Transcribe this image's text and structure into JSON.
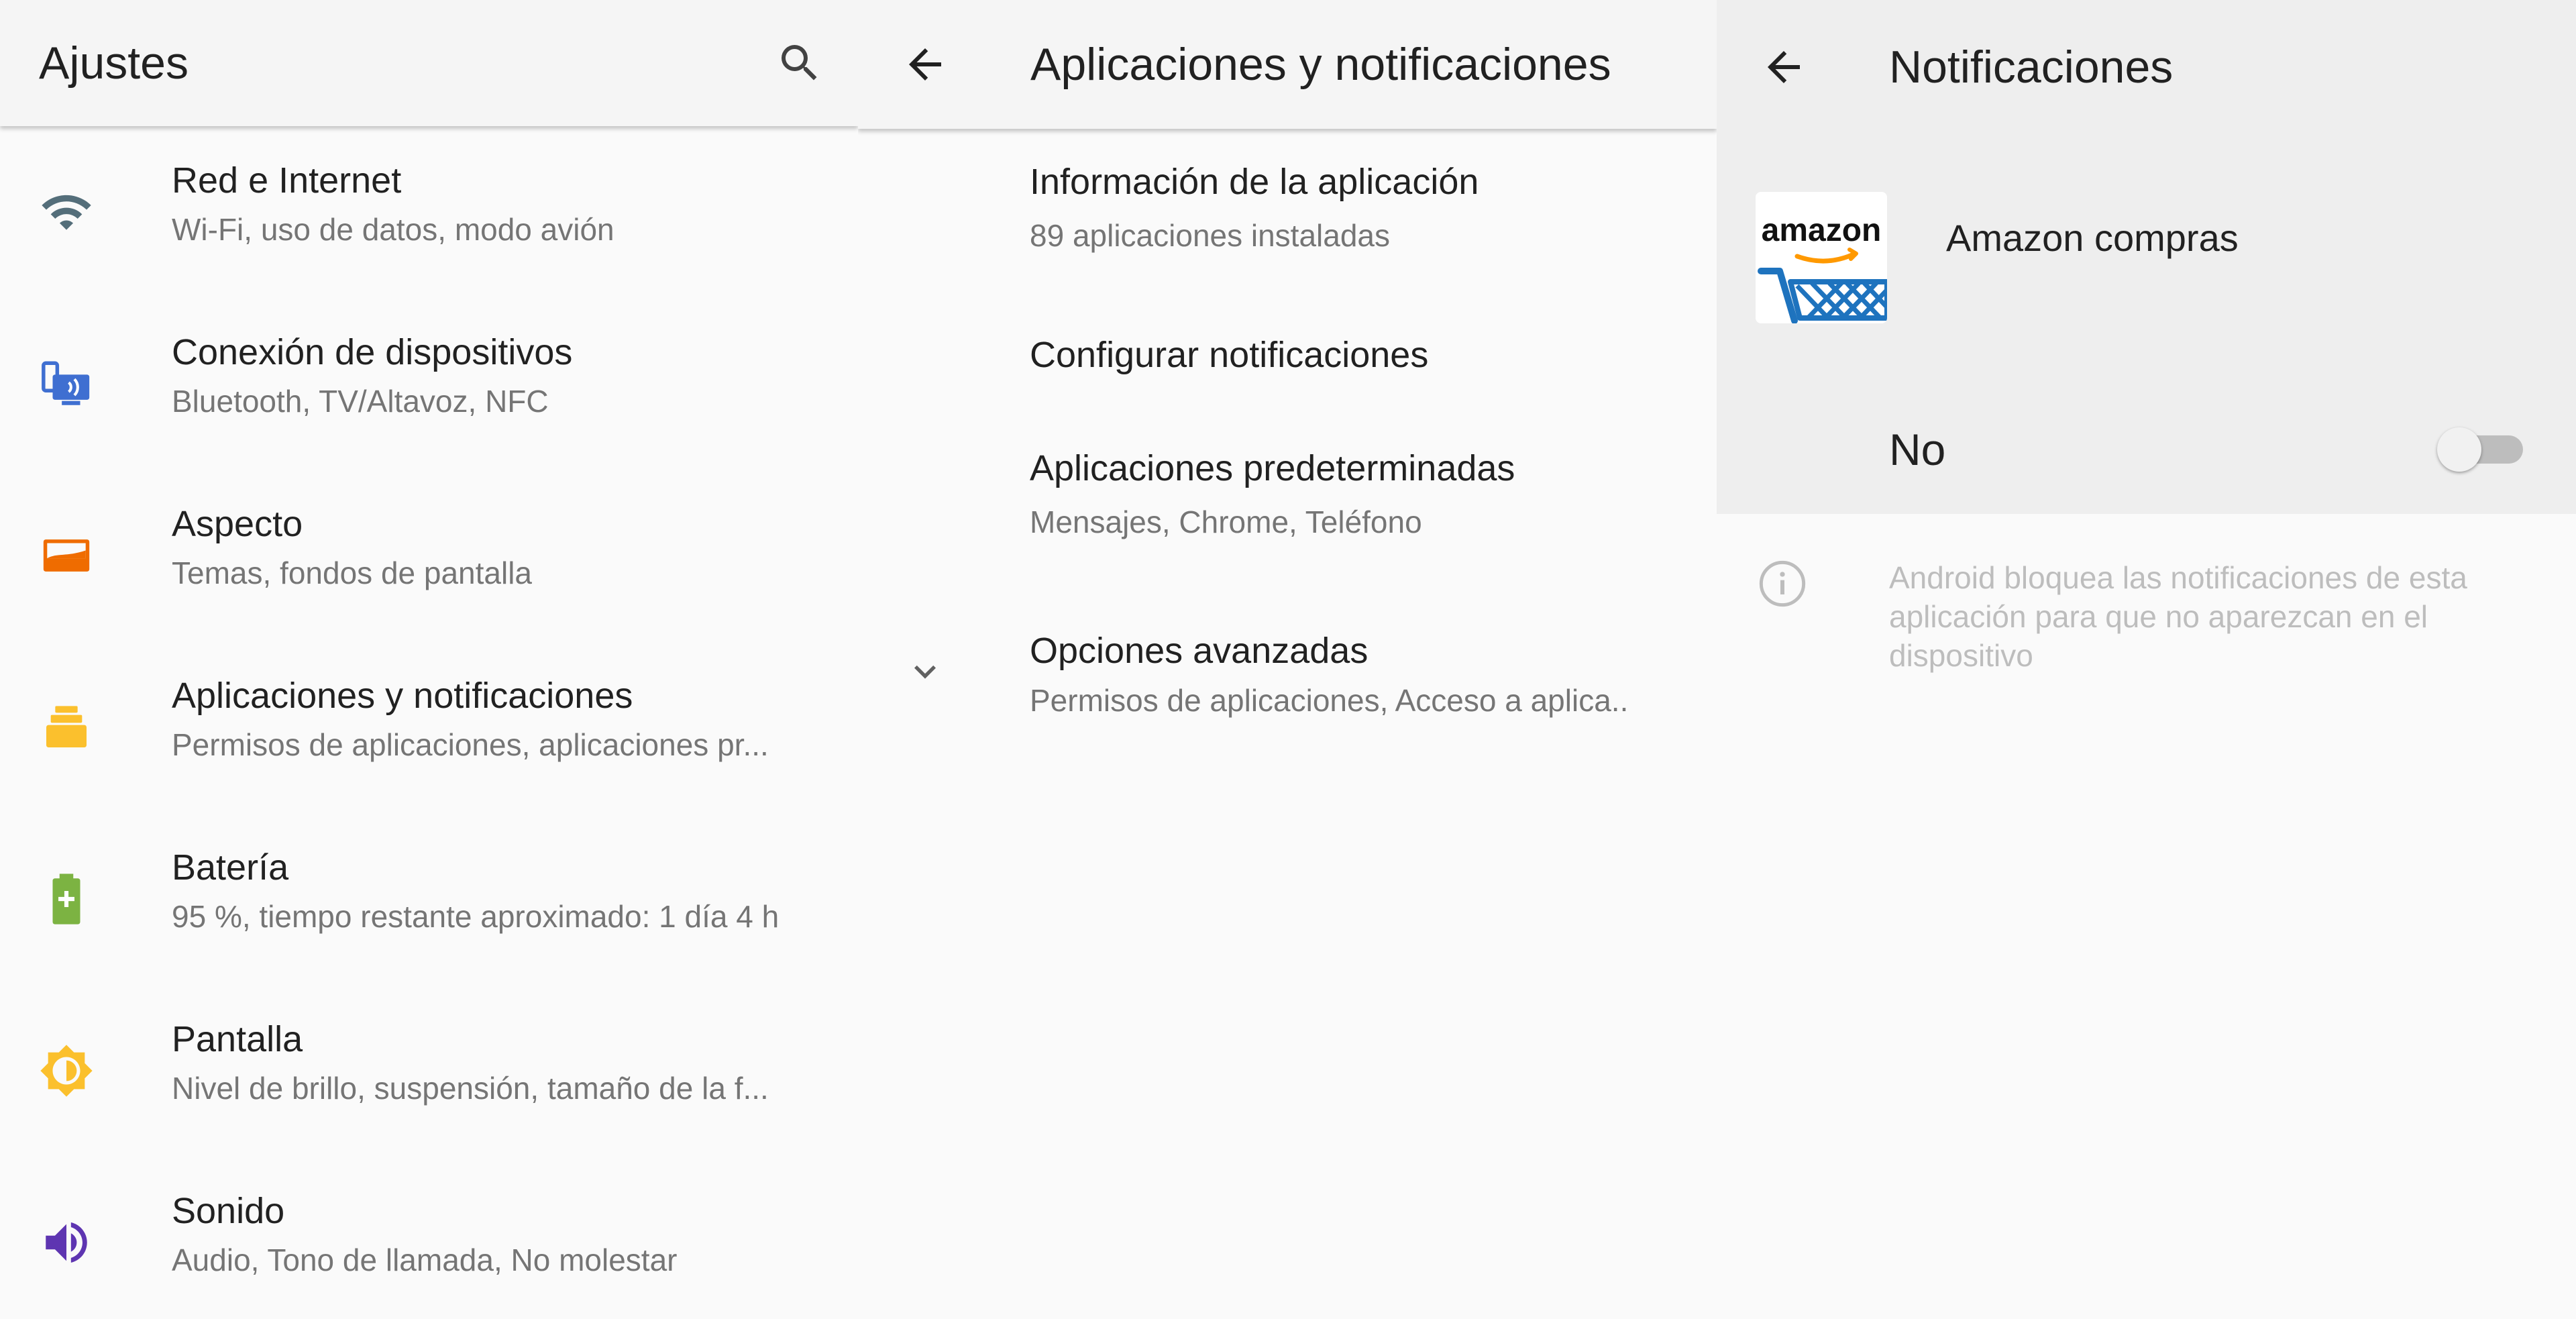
{
  "settings": {
    "title": "Ajustes",
    "items": [
      {
        "icon": "wifi-icon",
        "title": "Red e Internet",
        "subtitle": "Wi-Fi, uso de datos, modo avión",
        "color": "#546e7a"
      },
      {
        "icon": "devices-icon",
        "title": "Conexión de dispositivos",
        "subtitle": "Bluetooth, TV/Altavoz, NFC",
        "color": "#3f6fd1"
      },
      {
        "icon": "display-style-icon",
        "title": "Aspecto",
        "subtitle": "Temas, fondos de pantalla",
        "color": "#ef6c00"
      },
      {
        "icon": "apps-icon",
        "title": "Aplicaciones y notificaciones",
        "subtitle": "Permisos de aplicaciones, aplicaciones pr...",
        "color": "#fbc02d"
      },
      {
        "icon": "battery-icon",
        "title": "Batería",
        "subtitle": "95 %, tiempo restante aproximado: 1 día 4 h",
        "color": "#7cb342"
      },
      {
        "icon": "brightness-icon",
        "title": "Pantalla",
        "subtitle": "Nivel de brillo, suspensión, tamaño de la f...",
        "color": "#fbc02d"
      },
      {
        "icon": "volume-icon",
        "title": "Sonido",
        "subtitle": "Audio, Tono de llamada, No molestar",
        "color": "#5e35b1"
      }
    ]
  },
  "apps": {
    "title": "Aplicaciones y notificaciones",
    "items": [
      {
        "title": "Información de la aplicación",
        "subtitle": "89 aplicaciones instaladas"
      },
      {
        "title": "Configurar notificaciones",
        "subtitle": ""
      },
      {
        "title": "Aplicaciones predeterminadas",
        "subtitle": "Mensajes, Chrome, Teléfono"
      },
      {
        "title": "Opciones avanzadas",
        "subtitle": "Permisos de aplicaciones, Acceso a aplica.."
      }
    ]
  },
  "notifications": {
    "title": "Notificaciones",
    "app_name": "Amazon compras",
    "app_logo_text": "amazon",
    "toggle_label": "No",
    "toggle_on": false,
    "info_text": "Android bloquea las notificaciones de esta aplicación para que no aparezcan en el dispositivo"
  }
}
